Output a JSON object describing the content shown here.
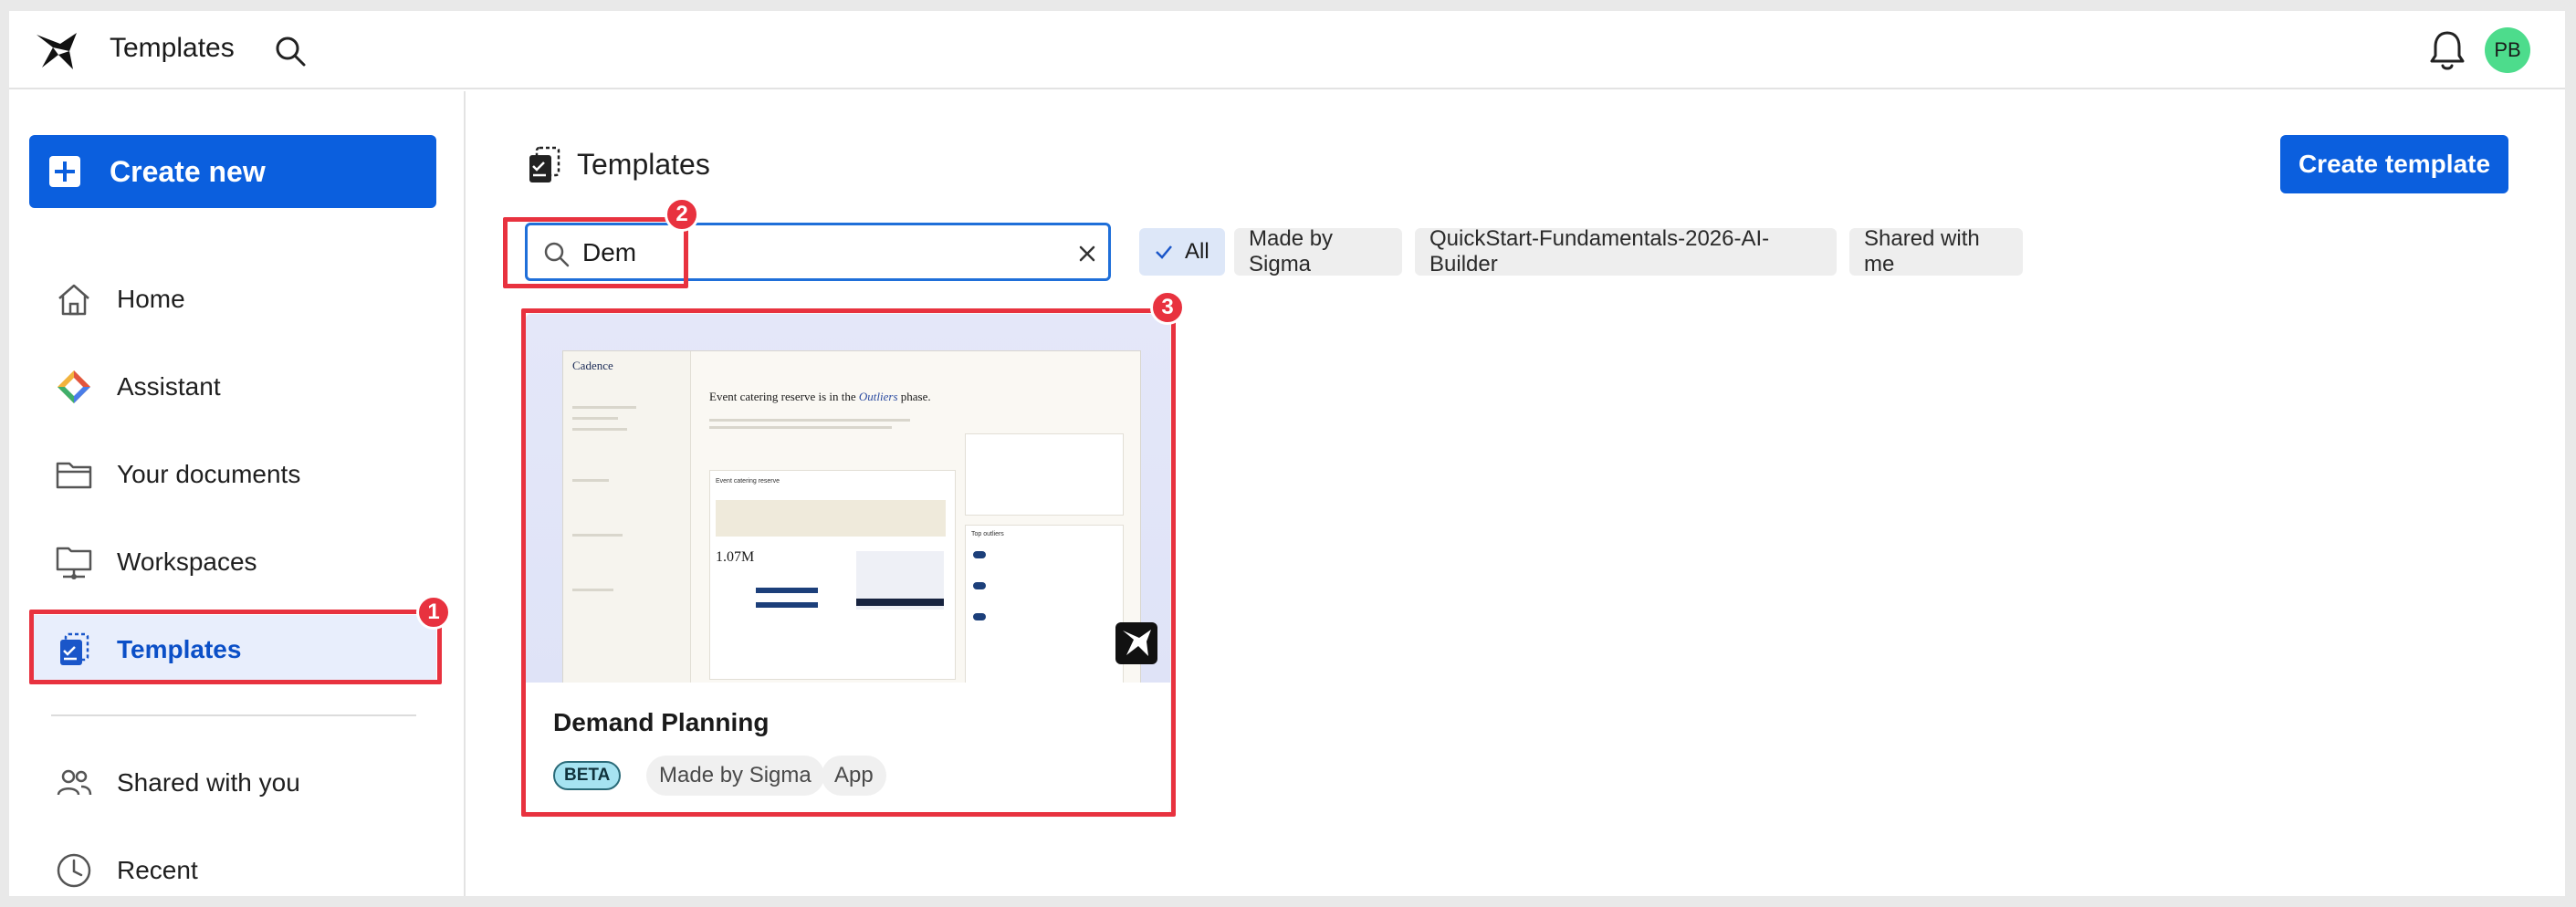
{
  "topbar": {
    "app_title": "Templates",
    "avatar_initials": "PB",
    "avatar_color": "#4ddc8c"
  },
  "sidebar": {
    "create_new_label": "Create new",
    "items": [
      {
        "label": "Home",
        "icon": "home-icon"
      },
      {
        "label": "Assistant",
        "icon": "assistant-icon"
      },
      {
        "label": "Your documents",
        "icon": "folder-icon"
      },
      {
        "label": "Workspaces",
        "icon": "workspaces-icon"
      },
      {
        "label": "Templates",
        "icon": "templates-icon",
        "active": true
      },
      {
        "label": "Shared with you",
        "icon": "shared-users-icon"
      },
      {
        "label": "Recent",
        "icon": "clock-icon"
      }
    ]
  },
  "main": {
    "page_title": "Templates",
    "create_template_label": "Create template",
    "search": {
      "value": "Dem",
      "placeholder": ""
    },
    "filters": [
      {
        "label": "All",
        "selected": true
      },
      {
        "label": "Made by Sigma",
        "selected": false
      },
      {
        "label": "QuickStart-Fundamentals-2026-AI-Builder",
        "selected": false
      },
      {
        "label": "Shared with me",
        "selected": false
      }
    ],
    "cards": [
      {
        "title": "Demand Planning",
        "tags": [
          "BETA",
          "Made by Sigma",
          "App"
        ],
        "preview": {
          "brand": "Cadence",
          "headline_start": "Event catering reserve is in the",
          "headline_emph": "Outliers",
          "headline_end": "phase.",
          "metric": "1.07M",
          "section": "Event catering reserve",
          "list_title": "Top outliers"
        }
      }
    ]
  },
  "annotations": [
    {
      "number": "1"
    },
    {
      "number": "2"
    },
    {
      "number": "3"
    }
  ],
  "colors": {
    "accent": "#0b5fde",
    "active_nav_bg": "#e8eefc",
    "annotation_red": "#e8323f"
  }
}
